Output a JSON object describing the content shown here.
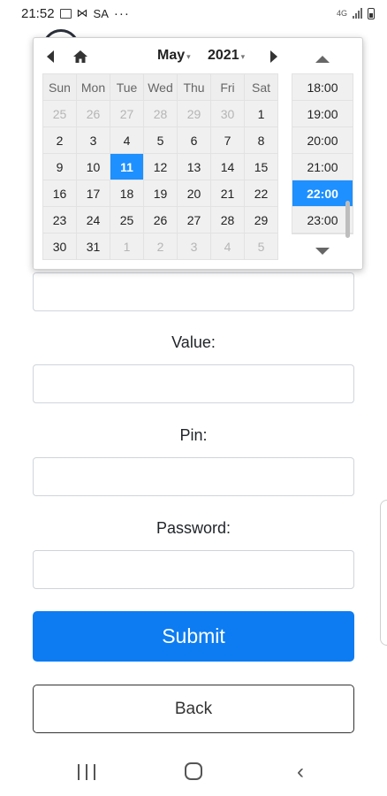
{
  "status_bar": {
    "time": "21:52",
    "carrier": "SA",
    "more": "···",
    "network": "4G"
  },
  "datepicker": {
    "month": "May",
    "year": "2021",
    "weekdays": [
      "Sun",
      "Mon",
      "Tue",
      "Wed",
      "Thu",
      "Fri",
      "Sat"
    ],
    "weeks": [
      [
        {
          "d": "25",
          "o": true
        },
        {
          "d": "26",
          "o": true
        },
        {
          "d": "27",
          "o": true
        },
        {
          "d": "28",
          "o": true
        },
        {
          "d": "29",
          "o": true
        },
        {
          "d": "30",
          "o": true
        },
        {
          "d": "1",
          "o": false
        }
      ],
      [
        {
          "d": "2",
          "o": false
        },
        {
          "d": "3",
          "o": false
        },
        {
          "d": "4",
          "o": false
        },
        {
          "d": "5",
          "o": false
        },
        {
          "d": "6",
          "o": false
        },
        {
          "d": "7",
          "o": false
        },
        {
          "d": "8",
          "o": false
        }
      ],
      [
        {
          "d": "9",
          "o": false
        },
        {
          "d": "10",
          "o": false
        },
        {
          "d": "11",
          "o": false,
          "sel": true
        },
        {
          "d": "12",
          "o": false
        },
        {
          "d": "13",
          "o": false
        },
        {
          "d": "14",
          "o": false
        },
        {
          "d": "15",
          "o": false
        }
      ],
      [
        {
          "d": "16",
          "o": false
        },
        {
          "d": "17",
          "o": false
        },
        {
          "d": "18",
          "o": false
        },
        {
          "d": "19",
          "o": false
        },
        {
          "d": "20",
          "o": false
        },
        {
          "d": "21",
          "o": false
        },
        {
          "d": "22",
          "o": false
        }
      ],
      [
        {
          "d": "23",
          "o": false
        },
        {
          "d": "24",
          "o": false
        },
        {
          "d": "25",
          "o": false
        },
        {
          "d": "26",
          "o": false
        },
        {
          "d": "27",
          "o": false
        },
        {
          "d": "28",
          "o": false
        },
        {
          "d": "29",
          "o": false
        }
      ],
      [
        {
          "d": "30",
          "o": false
        },
        {
          "d": "31",
          "o": false
        },
        {
          "d": "1",
          "o": true
        },
        {
          "d": "2",
          "o": true
        },
        {
          "d": "3",
          "o": true
        },
        {
          "d": "4",
          "o": true
        },
        {
          "d": "5",
          "o": true
        }
      ]
    ],
    "times": [
      "18:00",
      "19:00",
      "20:00",
      "21:00",
      "22:00",
      "23:00"
    ],
    "selected_time": "22:00",
    "accent_color": "#1e90ff"
  },
  "form": {
    "value_label": "Value:",
    "pin_label": "Pin:",
    "password_label": "Password:",
    "submit_label": "Submit",
    "back_label": "Back",
    "submit_color": "#0d7cf2"
  }
}
